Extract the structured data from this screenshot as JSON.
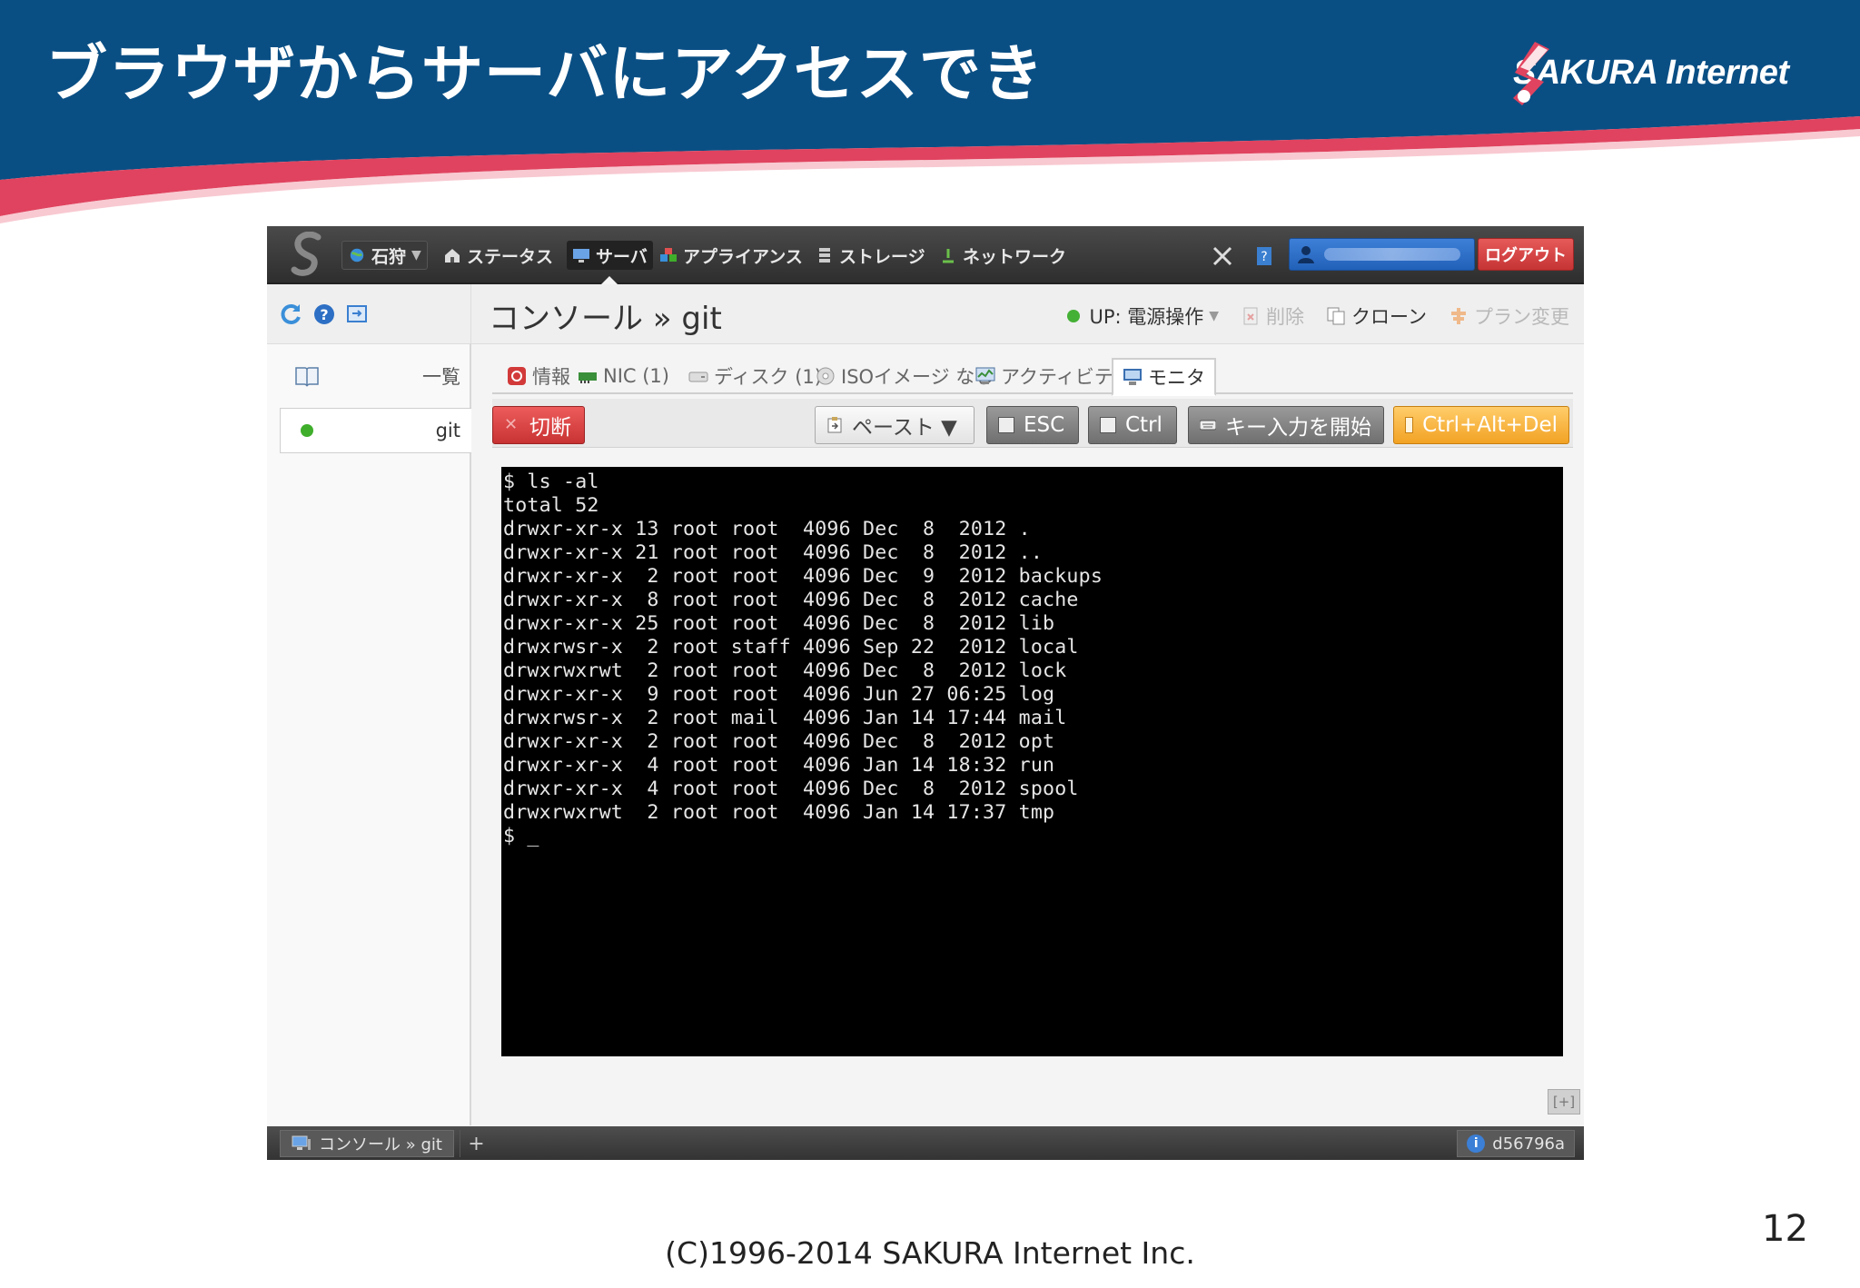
{
  "slide": {
    "title": "ブラウザからサーバにアクセスでき",
    "brand": "SAKURA Internet",
    "copyright": "(C)1996-2014 SAKURA Internet Inc.",
    "page_number": "12",
    "colors": {
      "header_blue": "#0a4f84",
      "accent_pink": "#e0435f"
    }
  },
  "app": {
    "topnav": {
      "zone": "石狩",
      "items": [
        "ステータス",
        "サーバ",
        "アプライアンス",
        "ストレージ",
        "ネットワーク"
      ],
      "active_item": "サーバ",
      "logout": "ログアウト"
    },
    "subbar": {
      "breadcrumb": "コンソール » git",
      "status": "UP: 電源操作",
      "actions": {
        "delete": "削除",
        "clone": "クローン",
        "plan_change": "プラン変更"
      }
    },
    "sidebar": {
      "list_label": "一覧",
      "server_name": "git"
    },
    "tabs": [
      "情報",
      "NIC (1)",
      "ディスク (1)",
      "ISOイメージ なし",
      "アクティビティ",
      "モニタ"
    ],
    "active_tab": "モニタ",
    "console_toolbar": {
      "disconnect": "切断",
      "paste": "ペースト ▼",
      "esc": "ESC",
      "ctrl": "Ctrl",
      "key_input": "キー入力を開始",
      "cad": "Ctrl+Alt+Del"
    },
    "terminal_lines": [
      "$ ls -al",
      "total 52",
      "drwxr-xr-x 13 root root  4096 Dec  8  2012 .",
      "drwxr-xr-x 21 root root  4096 Dec  8  2012 ..",
      "drwxr-xr-x  2 root root  4096 Dec  9  2012 backups",
      "drwxr-xr-x  8 root root  4096 Dec  8  2012 cache",
      "drwxr-xr-x 25 root root  4096 Dec  8  2012 lib",
      "drwxrwsr-x  2 root staff 4096 Sep 22  2012 local",
      "drwxrwxrwt  2 root root  4096 Dec  8  2012 lock",
      "drwxr-xr-x  9 root root  4096 Jun 27 06:25 log",
      "drwxrwsr-x  2 root mail  4096 Jan 14 17:44 mail",
      "drwxr-xr-x  2 root root  4096 Dec  8  2012 opt",
      "drwxr-xr-x  4 root root  4096 Jan 14 18:32 run",
      "drwxr-xr-x  4 root root  4096 Dec  8  2012 spool",
      "drwxrwxrwt  2 root root  4096 Jan 14 17:37 tmp",
      "$ _"
    ],
    "expand_button": "[+]",
    "footbar": {
      "tab": "コンソール » git",
      "plus": "+",
      "version": "d56796a"
    }
  }
}
